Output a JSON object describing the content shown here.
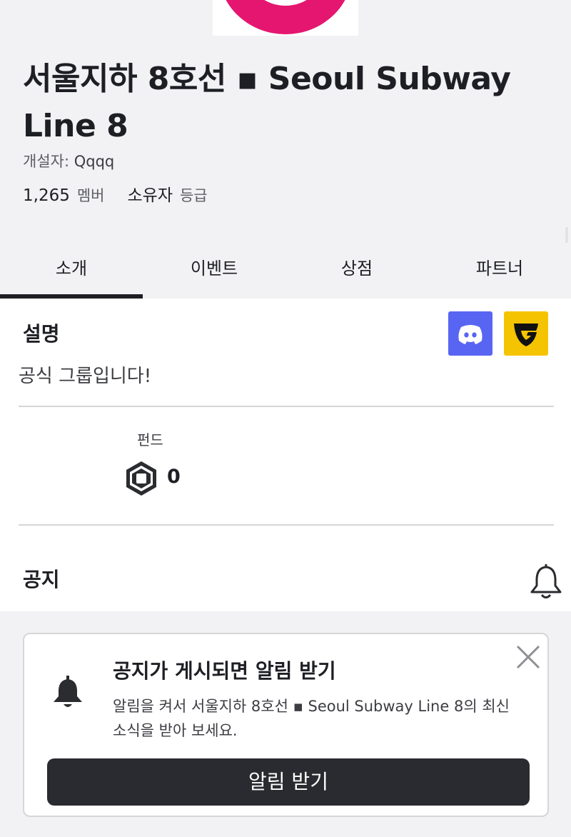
{
  "group": {
    "title": "서울지하 8호선 ▪ Seoul Subway Line 8",
    "creator_label": "개설자:",
    "creator_name": "Qqqq",
    "member_count": "1,265",
    "member_label": "멤버",
    "rank_value": "소유자",
    "rank_label": "등급"
  },
  "tabs": [
    {
      "label": "소개",
      "active": true
    },
    {
      "label": "이벤트",
      "active": false
    },
    {
      "label": "상점",
      "active": false
    },
    {
      "label": "파트너",
      "active": false
    }
  ],
  "description": {
    "title": "설명",
    "text": "공식 그룹입니다!",
    "social_icons": [
      "discord-icon",
      "guilded-icon"
    ]
  },
  "funds": {
    "label": "펀드",
    "value": "0",
    "icon": "robux-icon"
  },
  "notice": {
    "title": "공지",
    "icon": "bell-outline-icon"
  },
  "notify_card": {
    "title": "공지가 게시되면 알림 받기",
    "text": "알림을 켜서 서울지하 8호선 ▪ Seoul Subway Line 8의 최신 소식을 받아 보세요.",
    "button_label": "알림 받기",
    "icon": "bell-icon"
  },
  "colors": {
    "logo_ring": "#e4166f",
    "discord": "#5865f2",
    "guilded": "#f5c400",
    "button_bg": "#2a2b30",
    "page_bg": "#f2f2f4"
  }
}
